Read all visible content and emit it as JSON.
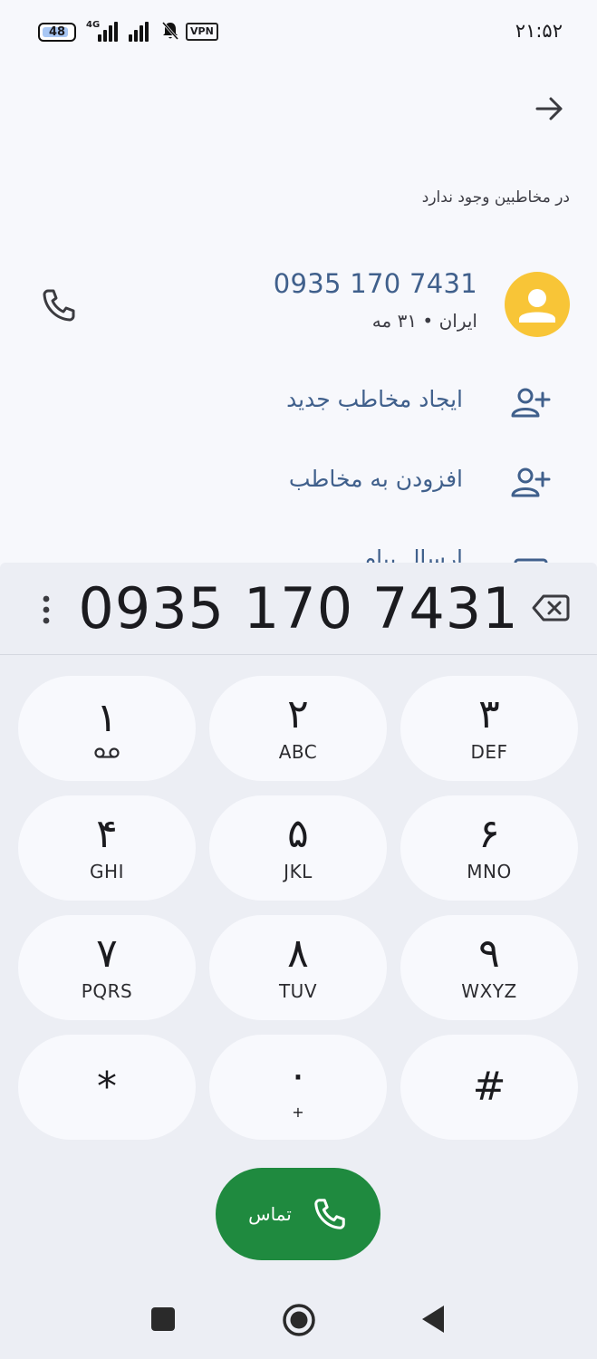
{
  "status": {
    "battery": "48",
    "network": "4G",
    "vpn": "VPN",
    "time": "۲۱:۵۲"
  },
  "header": {
    "no_contact_text": "در مخاطبین وجود ندارد"
  },
  "contact": {
    "number": "0935 170 7431",
    "meta": "ایران • ۳۱ مه"
  },
  "actions": [
    {
      "label": "ایجاد مخاطب جدید",
      "icon": "person-add-icon"
    },
    {
      "label": "افزودن به مخاطب",
      "icon": "person-add-icon"
    },
    {
      "label": "ارسال پیام",
      "icon": "message-icon"
    }
  ],
  "dialer": {
    "entered_number": "0935 170 7431",
    "keys": [
      {
        "digit": "۱",
        "letters": ""
      },
      {
        "digit": "۲",
        "letters": "ABC"
      },
      {
        "digit": "۳",
        "letters": "DEF"
      },
      {
        "digit": "۴",
        "letters": "GHI"
      },
      {
        "digit": "۵",
        "letters": "JKL"
      },
      {
        "digit": "۶",
        "letters": "MNO"
      },
      {
        "digit": "۷",
        "letters": "PQRS"
      },
      {
        "digit": "۸",
        "letters": "TUV"
      },
      {
        "digit": "۹",
        "letters": "WXYZ"
      },
      {
        "digit": "*",
        "letters": ""
      },
      {
        "digit": "۰",
        "letters": "+"
      },
      {
        "digit": "#",
        "letters": ""
      }
    ],
    "call_label": "تماس"
  },
  "colors": {
    "accent": "#40608c",
    "avatar": "#f8c537",
    "call_button": "#1f8a3f",
    "background": "#f7f8fc",
    "dialer_background": "#eceef4"
  }
}
